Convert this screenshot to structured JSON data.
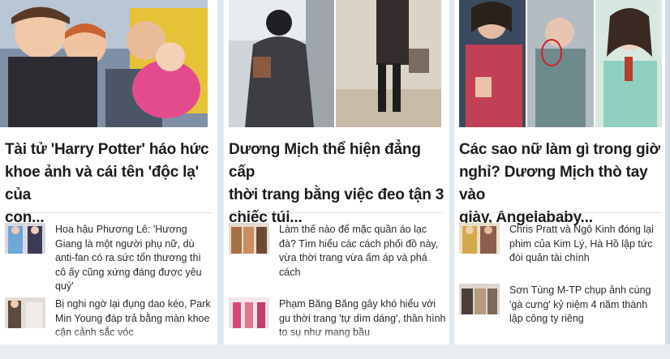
{
  "cards": [
    {
      "headline_lines": [
        "Tài tử 'Harry Potter' háo hức",
        "khoe ảnh và cái tên 'độc lạ' của",
        "con..."
      ],
      "items": [
        {
          "text": "Hoa hậu Phương Lê: 'Hương Giang là một người phụ nữ, dù anti-fan có ra sức tổn thương thì cô ấy cũng xứng đáng được yêu quý'"
        },
        {
          "text": "Bị nghi ngờ lại đụng dao kéo, Park Min Young đáp trả bằng màn khoe cận cảnh sắc vóc"
        }
      ]
    },
    {
      "headline_lines": [
        "Dương Mịch thể hiện đẳng cấp",
        "thời trang bằng việc đeo tận 3",
        "chiếc túi..."
      ],
      "items": [
        {
          "text": "Làm thế nào để mặc quần áo lạc đà? Tìm hiểu các cách phối đồ này, vừa thời trang vừa ấm áp và phá cách"
        },
        {
          "text": "Phạm Băng Băng gây khó hiểu với gu thời trang 'tự dìm dáng', thân hình to sụ như mang bầu"
        }
      ]
    },
    {
      "headline_lines": [
        "Các sao nữ làm gì trong giờ",
        "nghỉ? Dương Mịch thò tay vào",
        "giày, Angelababy..."
      ],
      "items": [
        {
          "text": "Chris Pratt và Ngô Kinh đóng lại phim của Kim Lý, Hà Hồ lập tức đòi quản tài chính"
        },
        {
          "text": "Sơn Tùng M-TP chụp ảnh cùng 'gà cưng' kỷ niệm 4 năm thành lập công ty riêng"
        }
      ]
    }
  ],
  "colors": {
    "accent_pink": "#e75a8f",
    "text": "#1c1c1c"
  }
}
